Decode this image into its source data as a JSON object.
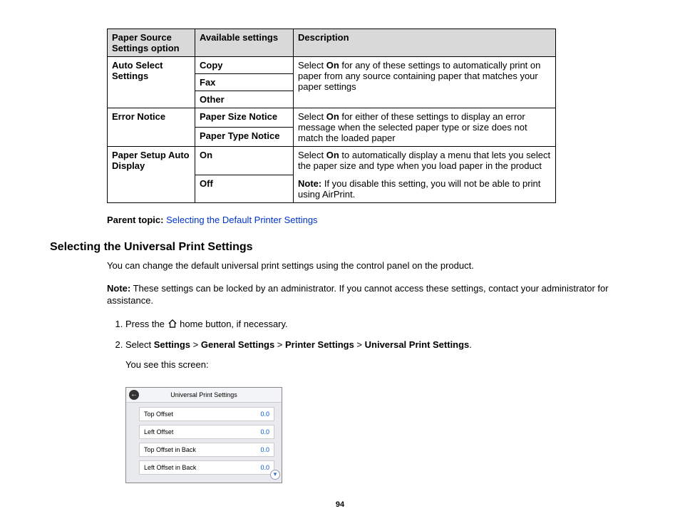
{
  "table": {
    "headers": [
      "Paper Source Settings option",
      "Available settings",
      "Description"
    ],
    "rows": [
      {
        "option": "Auto Select Settings",
        "settings": [
          "Copy",
          "Fax",
          "Other"
        ],
        "desc_pre": "Select ",
        "desc_bold": "On",
        "desc_post": " for any of these settings to automatically print on paper from any source containing paper that matches your paper settings"
      },
      {
        "option": "Error Notice",
        "settings": [
          "Paper Size Notice",
          "Paper Type Notice"
        ],
        "desc_pre": "Select ",
        "desc_bold": "On",
        "desc_post": " for either of these settings to display an error message when the selected paper type or size does not match the loaded paper"
      },
      {
        "option": "Paper Setup Auto Display",
        "settings": [
          "On",
          "Off"
        ],
        "desc_pre": "Select ",
        "desc_bold": "On",
        "desc_post": " to automatically display a menu that lets you select the paper size and type when you load paper in the product",
        "note_label": "Note:",
        "note_text": " If you disable this setting, you will not be able to print using AirPrint."
      }
    ]
  },
  "parent_topic": {
    "label": "Parent topic:",
    "link": "Selecting the Default Printer Settings"
  },
  "heading": "Selecting the Universal Print Settings",
  "intro": "You can change the default universal print settings using the control panel on the product.",
  "note_label": "Note:",
  "note_text": " These settings can be locked by an administrator. If you cannot access these settings, contact your administrator for assistance.",
  "steps": {
    "s1_pre": "Press the ",
    "s1_post": " home button, if necessary.",
    "s2_pre": "Select ",
    "s2_b1": "Settings",
    "s2_b2": "General Settings",
    "s2_b3": "Printer Settings",
    "s2_b4": "Universal Print Settings",
    "s2_sep": " > ",
    "s2_end": ".",
    "s2_after": "You see this screen:"
  },
  "screen": {
    "title": "Universal Print Settings",
    "items": [
      {
        "label": "Top Offset",
        "value": "0.0"
      },
      {
        "label": "Left Offset",
        "value": "0.0"
      },
      {
        "label": "Top Offset in Back",
        "value": "0.0"
      },
      {
        "label": "Left Offset in Back",
        "value": "0.0"
      }
    ]
  },
  "page_number": "94"
}
